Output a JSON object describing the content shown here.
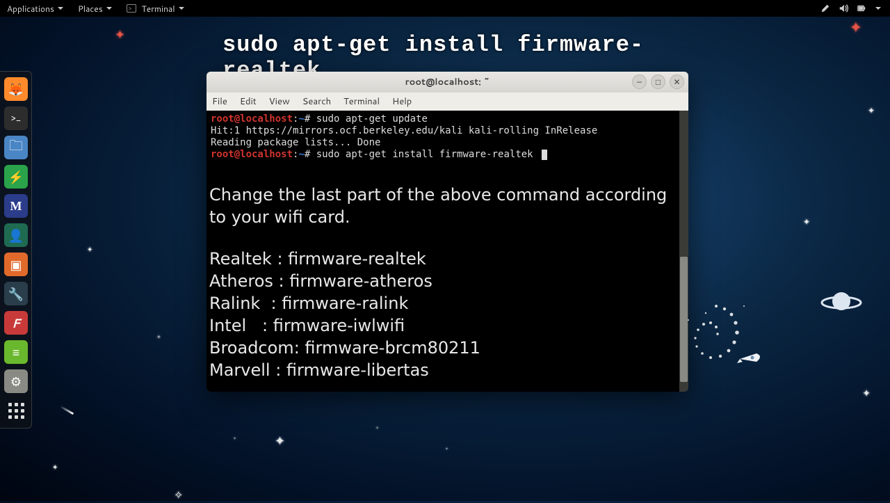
{
  "panel": {
    "applications": "Applications",
    "places": "Places",
    "terminal": "Terminal"
  },
  "caption": "sudo apt-get install firmware-realtek",
  "dock": {
    "firefox": "🦊",
    "terminal": ">_",
    "files": "📁",
    "update": "⚡",
    "metasploit": "M",
    "maltego": "👤",
    "burp": "▣",
    "wireshark": "🔧",
    "faraday": "F",
    "notes": "≡",
    "settings": "⚙",
    "apps": ""
  },
  "terminal": {
    "title": "root@localhost: ~",
    "menu": {
      "file": "File",
      "edit": "Edit",
      "view": "View",
      "search": "Search",
      "terminal": "Terminal",
      "help": "Help"
    },
    "prompt_user": "root@localhost",
    "prompt_sep": ":",
    "prompt_path": "~",
    "prompt_end": "# ",
    "cmd1": "sudo apt-get update",
    "out1": "Hit:1 https://mirrors.ocf.berkeley.edu/kali kali-rolling InRelease",
    "out2": "Reading package lists... Done",
    "cmd2": "sudo apt-get install firmware-realtek "
  },
  "overlay": {
    "intro": "Change the last part of the above command according to your wifi card.",
    "lines": [
      "Realtek : firmware-realtek",
      "Atheros : firmware-atheros",
      "Ralink  : firmware-ralink",
      "Intel   : firmware-iwlwifi",
      "Broadcom: firmware-brcm80211",
      "Marvell : firmware-libertas"
    ]
  },
  "winbtn": {
    "min": "–",
    "max": "□",
    "close": "✕"
  }
}
